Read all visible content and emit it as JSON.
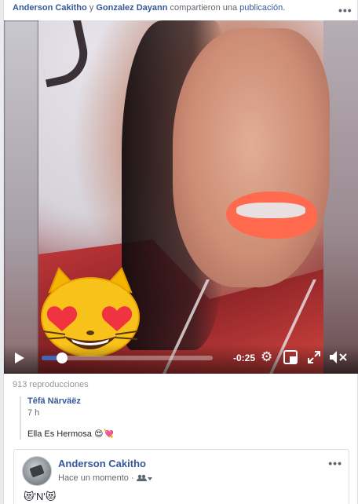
{
  "header": {
    "user1": "Anderson Cakitho",
    "conjunction": "y",
    "user2": "Gonzalez Dayann",
    "action": "compartieron una",
    "object": "publicación."
  },
  "video": {
    "time_remaining": "-0:25",
    "progress_fraction": 0.12,
    "views": "913 reproducciones"
  },
  "shared_post": {
    "author": "Têfä Närväëz",
    "time": "7 h",
    "text": "Ella Es Hermosa 😍💘"
  },
  "comment": {
    "author": "Anderson Cakitho",
    "meta": "Hace un momento ·",
    "text": "😻'N'😻"
  },
  "icons": {
    "more": "more-options-icon",
    "play": "play-icon",
    "settings": "gear-icon",
    "pip": "picture-in-picture-icon",
    "fullscreen": "fullscreen-icon",
    "mute": "volume-muted-icon",
    "audience": "friends-audience-icon"
  },
  "colors": {
    "link": "#365899",
    "progress": "#4267b2",
    "muted_text": "#90949c"
  }
}
